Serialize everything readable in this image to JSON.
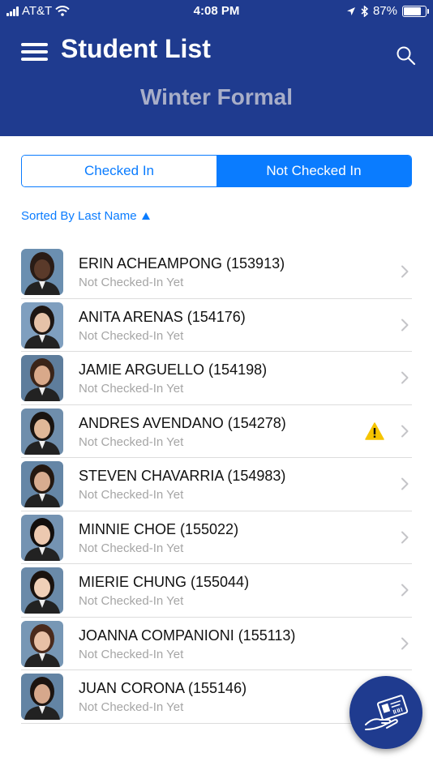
{
  "status_bar": {
    "carrier": "AT&T",
    "time": "4:08 PM",
    "battery": "87%",
    "battery_level": 0.87
  },
  "header": {
    "title": "Student List",
    "subtitle": "Winter Formal"
  },
  "tabs": {
    "checked_in": "Checked In",
    "not_checked_in": "Not Checked In",
    "active": "not_checked_in"
  },
  "sort": {
    "label": "Sorted By Last Name"
  },
  "students": [
    {
      "name": "ERIN ACHEAMPONG (153913)",
      "status": "Not Checked-In Yet",
      "warning": false
    },
    {
      "name": "ANITA ARENAS (154176)",
      "status": "Not Checked-In Yet",
      "warning": false
    },
    {
      "name": "JAMIE ARGUELLO (154198)",
      "status": "Not Checked-In Yet",
      "warning": false
    },
    {
      "name": "ANDRES AVENDANO (154278)",
      "status": "Not Checked-In Yet",
      "warning": true
    },
    {
      "name": "STEVEN CHAVARRIA (154983)",
      "status": "Not Checked-In Yet",
      "warning": false
    },
    {
      "name": "MINNIE CHOE (155022)",
      "status": "Not Checked-In Yet",
      "warning": false
    },
    {
      "name": "MIERIE CHUNG (155044)",
      "status": "Not Checked-In Yet",
      "warning": false
    },
    {
      "name": "JOANNA COMPANIONI (155113)",
      "status": "Not Checked-In Yet",
      "warning": false
    },
    {
      "name": "JUAN CORONA (155146)",
      "status": "Not Checked-In Yet",
      "warning": false
    }
  ],
  "colors": {
    "header_bg": "#1f3b8f",
    "accent": "#0a7cff",
    "warning": "#f5c400"
  }
}
